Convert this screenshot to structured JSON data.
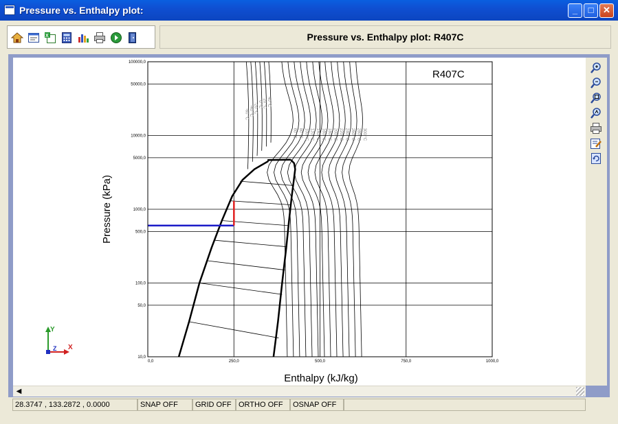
{
  "window": {
    "title": "Pressure vs. Enthalpy plot:"
  },
  "header": {
    "title": "Pressure vs. Enthalpy plot: R407C"
  },
  "toolbar": {
    "icons": [
      "home-icon",
      "window-icon",
      "export-icon",
      "calculator-icon",
      "chart-icon",
      "print-icon",
      "go-icon",
      "exit-icon"
    ]
  },
  "sidebar": {
    "icons": [
      "zoom-in-icon",
      "zoom-out-icon",
      "zoom-extents-icon",
      "zoom-window-icon",
      "print-icon",
      "edit-icon",
      "refresh-icon"
    ]
  },
  "chart_data": {
    "type": "line",
    "title": "R407C",
    "xlabel": "Enthalpy (kJ/kg)",
    "ylabel": "Pressure (kPa)",
    "xscale": "linear",
    "yscale": "log",
    "xlim": [
      0,
      1000
    ],
    "ylim": [
      10,
      100000
    ],
    "x_tick_labels": [
      "0,0",
      "250,0",
      "500,0",
      "750,0",
      "1000,0"
    ],
    "y_tick_labels": [
      "10,0",
      "50,0",
      "100,0",
      "500,0",
      "1000,0",
      "5000,0",
      "10000,0",
      "50000,0",
      "100000,0"
    ],
    "x_ticks": [
      0,
      250,
      500,
      750,
      1000
    ],
    "y_ticks": [
      10,
      50,
      100,
      500,
      1000,
      5000,
      10000,
      50000,
      100000
    ],
    "grid": true,
    "saturation_dome": {
      "liquid": [
        [
          90,
          10
        ],
        [
          120,
          30
        ],
        [
          150,
          100
        ],
        [
          185,
          300
        ],
        [
          215,
          700
        ],
        [
          245,
          1500
        ],
        [
          275,
          2500
        ],
        [
          310,
          3500
        ],
        [
          350,
          4500
        ]
      ],
      "vapor": [
        [
          365,
          10
        ],
        [
          378,
          30
        ],
        [
          390,
          100
        ],
        [
          402,
          300
        ],
        [
          410,
          700
        ],
        [
          418,
          1500
        ],
        [
          425,
          2700
        ],
        [
          428,
          3500
        ],
        [
          425,
          4200
        ],
        [
          415,
          4700
        ]
      ],
      "top": [
        350,
        4650
      ]
    },
    "quality_lines": [
      [
        [
          118,
          30
        ],
        [
          380,
          18
        ]
      ],
      [
        [
          150,
          100
        ],
        [
          390,
          70
        ]
      ],
      [
        [
          175,
          200
        ],
        [
          398,
          150
        ]
      ],
      [
        [
          195,
          380
        ],
        [
          404,
          310
        ]
      ],
      [
        [
          218,
          700
        ],
        [
          410,
          600
        ]
      ],
      [
        [
          240,
          1300
        ],
        [
          415,
          1150
        ]
      ],
      [
        [
          268,
          2400
        ],
        [
          421,
          2100
        ]
      ]
    ],
    "highlight_lines": [
      {
        "color": "#1a1ac8",
        "points": [
          [
            0,
            600
          ],
          [
            250,
            600
          ]
        ]
      },
      {
        "color": "#e02020",
        "points": [
          [
            250,
            600
          ],
          [
            250,
            1300
          ]
        ]
      }
    ],
    "isotherm_labels": [
      "-60 °C",
      "-40 °C",
      "-20 °C",
      "0 °C",
      "20 °C",
      "40 °C",
      "60 °C",
      "80 °C",
      "100 °C",
      "120 °C",
      "140 °C",
      "160 °C",
      "180 °C",
      "200 °C",
      "220 °C",
      "240 °C",
      "260 °C",
      "280 °C",
      "300 °C"
    ]
  },
  "axes_indicator": {
    "x": "X",
    "y": "Y",
    "z": "Z"
  },
  "status": {
    "coords": "28.3747 , 133.2872 , 0.0000",
    "snap": "SNAP OFF",
    "grid": "GRID OFF",
    "ortho": "ORTHO OFF",
    "osnap": "OSNAP OFF"
  }
}
